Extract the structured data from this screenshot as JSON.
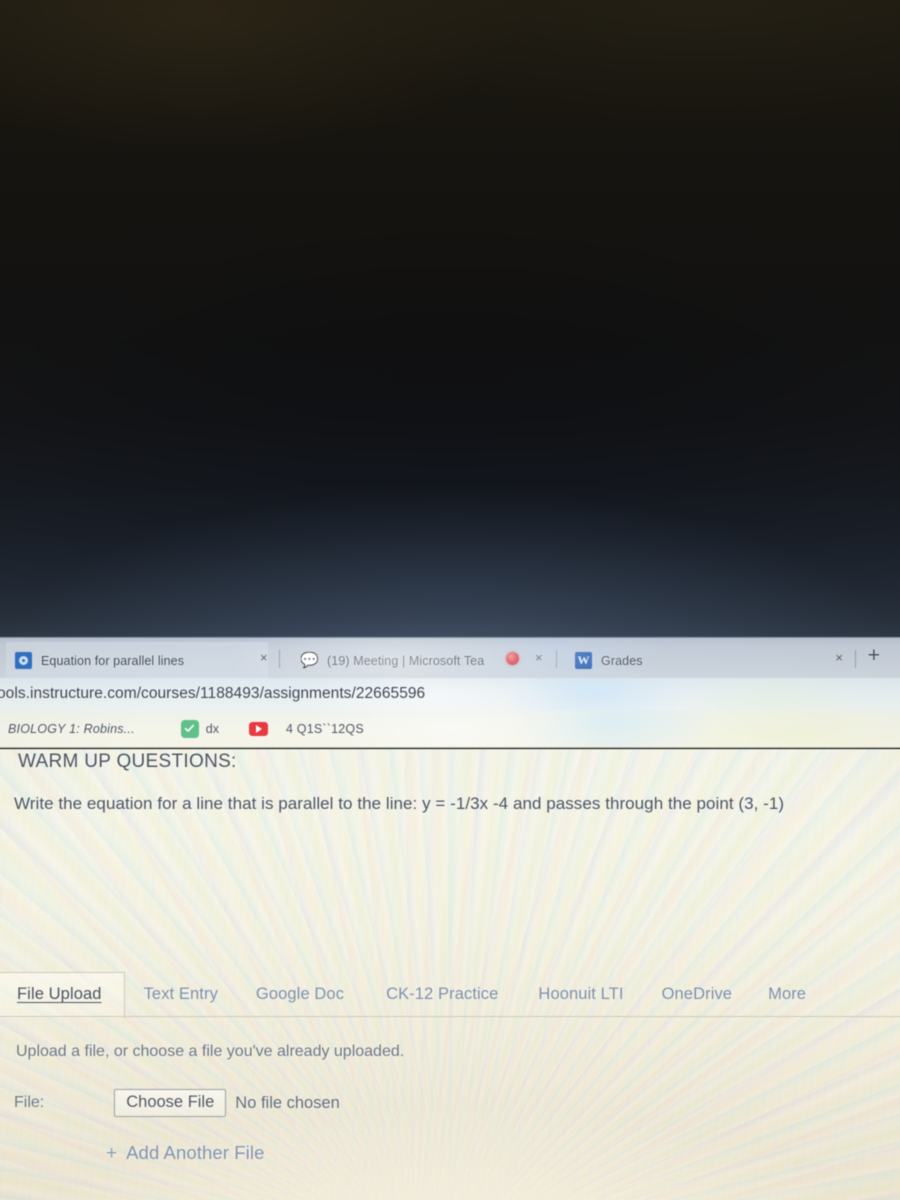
{
  "browser": {
    "tabs": [
      {
        "title": "Equation for parallel lines",
        "favicon": "canvas-icon",
        "close_label": "×",
        "recording": false,
        "active": true
      },
      {
        "title": "(19) Meeting | Microsoft Tea",
        "favicon": "teams-icon",
        "close_label": "×",
        "recording": true,
        "active": false
      },
      {
        "title": "Grades",
        "favicon": "word-icon",
        "close_label": "",
        "recording": false,
        "active": false
      }
    ],
    "window_close_label": "×",
    "new_tab_label": "+",
    "url": "ools.instructure.com/courses/1188493/assignments/22665596",
    "bookmarks": [
      {
        "label": "BIOLOGY 1: Robins...",
        "icon": ""
      },
      {
        "label": "dx",
        "icon": "green-check-icon"
      },
      {
        "label": "4 Q1S``12QS",
        "icon": "youtube-icon"
      }
    ]
  },
  "content": {
    "heading": "WARM UP QUESTIONS:",
    "question": "Write the equation for a line that is parallel to the line: y = -1/3x -4 and passes through the point (3, -1)",
    "submission_tabs": [
      {
        "label": "File Upload",
        "active": true
      },
      {
        "label": "Text Entry",
        "active": false
      },
      {
        "label": "Google Doc",
        "active": false
      },
      {
        "label": "CK-12 Practice",
        "active": false
      },
      {
        "label": "Hoonuit LTI",
        "active": false
      },
      {
        "label": "OneDrive",
        "active": false
      },
      {
        "label": "More",
        "active": false
      }
    ],
    "upload": {
      "note": "Upload a file, or choose a file you've already uploaded.",
      "file_label": "File:",
      "choose_file_button": "Choose File",
      "no_file_text": "No file chosen",
      "add_another_plus": "+",
      "add_another_label": "Add Another File"
    }
  },
  "colors": {
    "accent_link": "#8292ad",
    "tab_active_text": "#4b535e",
    "tab_inactive_text": "#7d8fa8",
    "recording_dot": "#e03a3e",
    "check_icon_bg": "#5fc08a",
    "youtube_bg": "#e8393f",
    "canvas_favicon": "#2d6fc4",
    "page_bg": "#f7f4e9",
    "dark_area": "#0b0b0b"
  }
}
